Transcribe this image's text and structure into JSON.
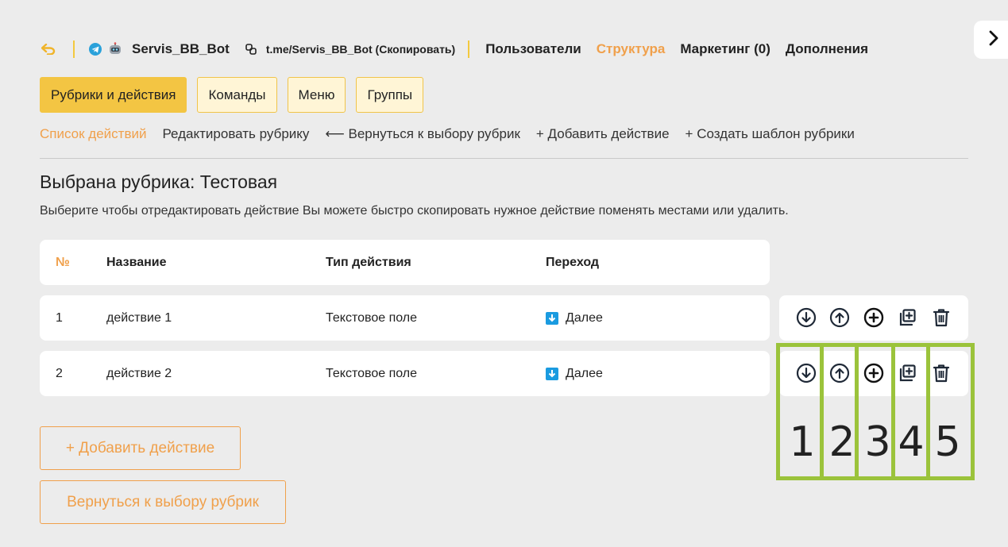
{
  "header": {
    "bot_name": "Servis_BB_Bot",
    "bot_link": "t.me/Servis_BB_Bot (Скопировать)",
    "nav": [
      "Пользователи",
      "Структура",
      "Маркетинг (0)",
      "Дополнения"
    ]
  },
  "tabs": [
    "Рубрики и действия",
    "Команды",
    "Меню",
    "Группы"
  ],
  "subnav": [
    "Список действий",
    "Редактировать рубрику",
    "⟵ Вернуться к выбору рубрик",
    "+ Добавить действие",
    "+ Создать шаблон рубрики"
  ],
  "heading": "Выбрана рубрика: Тестовая",
  "description": "Выберите чтобы отредактировать действие Вы можете быстро скопировать нужное действие поменять местами или удалить.",
  "table": {
    "headers": [
      "№",
      "Название",
      "Тип действия",
      "Переход"
    ],
    "rows": [
      {
        "num": "1",
        "name": "действие 1",
        "type": "Текстовое поле",
        "next": "Далее"
      },
      {
        "num": "2",
        "name": "действие 2",
        "type": "Текстовое поле",
        "next": "Далее"
      }
    ]
  },
  "action_icons": [
    "move-down-icon",
    "move-up-icon",
    "add-icon",
    "copy-icon",
    "delete-icon"
  ],
  "highlight_numbers": [
    "1",
    "2",
    "3",
    "4",
    "5"
  ],
  "buttons": {
    "add_action": "+ Добавить действие",
    "back_to_rubrics": "Вернуться к выбору рубрик"
  },
  "colors": {
    "accent_orange": "#f0a04b",
    "accent_yellow": "#f3c543",
    "highlight_green": "#9bc33b",
    "telegram_blue": "#2aa1da"
  }
}
